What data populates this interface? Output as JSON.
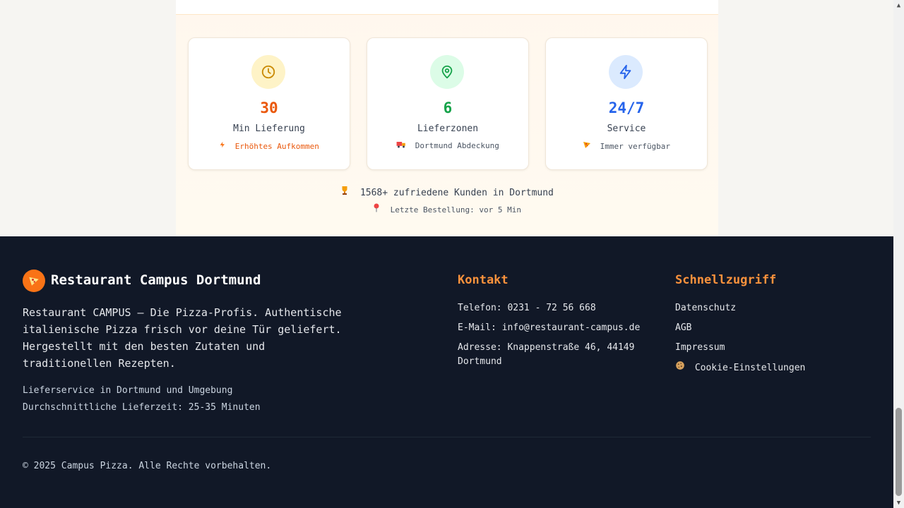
{
  "stats": {
    "cards": [
      {
        "value": "30",
        "label": "Min Lieferung",
        "sub_icon": "lightning-icon",
        "sub": "Erhöhtes Aufkommen",
        "accent": "#ea580c",
        "circle": "#fef3c7",
        "icon_color": "#ca8a04"
      },
      {
        "value": "6",
        "label": "Lieferzonen",
        "sub_icon": "truck-icon",
        "sub": "Dortmund Abdeckung",
        "accent": "#16a34a",
        "circle": "#dcfce7",
        "icon_color": "#16a34a"
      },
      {
        "value": "24/7",
        "label": "Service",
        "sub_icon": "pizza-icon",
        "sub": "Immer verfügbar",
        "accent": "#2563eb",
        "circle": "#dbeafe",
        "icon_color": "#2563eb"
      }
    ],
    "customers": "1568+ zufriedene Kunden in Dortmund",
    "last_order": "Letzte Bestellung: vor 5 Min"
  },
  "footer": {
    "brand_title": "Restaurant Campus Dortmund",
    "brand_desc": "Restaurant CAMPUS – Die Pizza-Profis. Authentische italienische Pizza frisch vor deine Tür geliefert. Hergestellt mit den besten Zutaten und traditionellen Rezepten.",
    "service_area": "Lieferservice in Dortmund und Umgebung",
    "avg_time": "Durchschnittliche Lieferzeit: 25-35 Minuten",
    "contact_title": "Kontakt",
    "phone": "Telefon: 0231 - 72 56 668",
    "email": "E-Mail: info@restaurant-campus.de",
    "address": "Adresse: Knappenstraße 46, 44149 Dortmund",
    "quick_title": "Schnellzugriff",
    "links": {
      "privacy": "Datenschutz",
      "terms": "AGB",
      "imprint": "Impressum",
      "cookies": "Cookie-Einstellungen"
    },
    "copyright": "© 2025 Campus Pizza. Alle Rechte vorbehalten."
  }
}
